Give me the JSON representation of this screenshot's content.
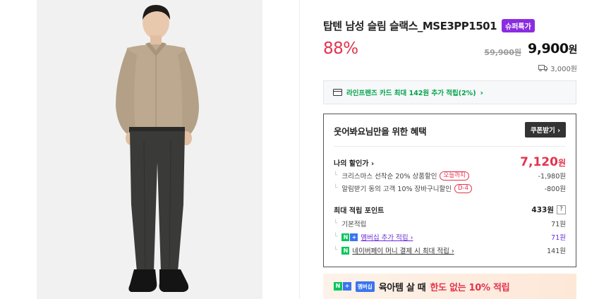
{
  "product": {
    "title": "탑텐 남성 슬림 슬랙스_MSE3PP1501",
    "badge": "슈퍼특가",
    "discount": "88%",
    "original_price": "59,900원",
    "sale_price_num": "9,900",
    "sale_price_unit": "원",
    "shipping_fee": "3,000원"
  },
  "card_banner": {
    "text": "라인프렌즈 카드 최대 142원 추가 적립(2%)",
    "arrow": "›"
  },
  "benefit": {
    "title": "웃어봐요님만을 위한 혜택",
    "coupon_button": "쿠폰받기 ›",
    "my_price_label": "나의 할인가 ›",
    "my_price_num": "7,120",
    "my_price_unit": "원",
    "discounts": [
      {
        "label": "크리스마스 선착순 20% 상품할인",
        "tag": "오늘까지",
        "value": "-1,980원"
      },
      {
        "label": "알림받기 동의 고객 10% 장바구니할인",
        "tag": "D-4",
        "value": "-800원"
      }
    ],
    "points_label": "최대 적립 포인트",
    "points_value": "433원",
    "points_help": "?",
    "points": [
      {
        "label": "기본적립",
        "value": "71원"
      },
      {
        "label": "멤버십 추가 적립 ›",
        "value": "71원"
      },
      {
        "label": "네이버페이 머니 결제 시 최대 적립 ›",
        "value": "141원"
      }
    ]
  },
  "promo": {
    "membership_tag": "멤버십",
    "text": "육아템 살 때",
    "highlight": "한도 없는 10% 적립"
  },
  "colors": {
    "accent_red": "#e4334d",
    "badge_purple": "#8b2be2",
    "naver_green": "#03c75a"
  }
}
